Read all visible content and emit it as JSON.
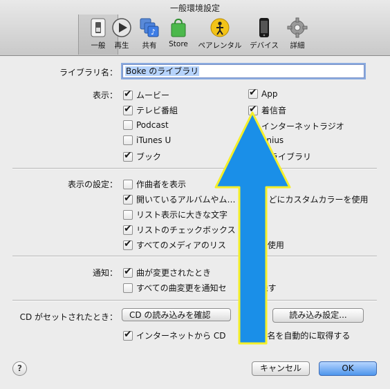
{
  "window": {
    "title": "一般環境設定"
  },
  "toolbar": {
    "items": [
      {
        "label": "一般",
        "icon": "general-switch-icon"
      },
      {
        "label": "再生",
        "icon": "play-icon"
      },
      {
        "label": "共有",
        "icon": "sharing-icon"
      },
      {
        "label": "Store",
        "icon": "store-bag-icon"
      },
      {
        "label": "ペアレンタル",
        "icon": "parental-icon"
      },
      {
        "label": "デバイス",
        "icon": "device-icon"
      },
      {
        "label": "詳細",
        "icon": "gear-icon"
      }
    ]
  },
  "library": {
    "label": "ライブラリ名：",
    "value": "Boke のライブラリ"
  },
  "display": {
    "label": "表示：",
    "left": [
      {
        "label": "ムービー",
        "checked": true
      },
      {
        "label": "テレビ番組",
        "checked": true
      },
      {
        "label": "Podcast",
        "checked": false
      },
      {
        "label": "iTunes U",
        "checked": false
      },
      {
        "label": "ブック",
        "checked": true
      }
    ],
    "right": [
      {
        "label": "App",
        "checked": true
      },
      {
        "label": "着信音",
        "checked": true
      },
      {
        "label": "インターネットラジオ",
        "checked": false
      },
      {
        "label": "enius",
        "checked": false
      },
      {
        "label": "有ライブラリ",
        "checked": false
      }
    ]
  },
  "display_settings": {
    "label": "表示の設定：",
    "options": [
      {
        "label": "作曲者を表示",
        "checked": false
      },
      {
        "label": "開いているアルバムやム…　　　　どにカスタムカラーを使用",
        "checked": true
      },
      {
        "label": "リスト表示に大きな文字",
        "checked": false
      },
      {
        "label": "リストのチェックボックス",
        "checked": true
      },
      {
        "label": "すべてのメディアのリス　　　　　使用",
        "checked": true
      }
    ]
  },
  "notifications": {
    "label": "通知：",
    "options": [
      {
        "label": "曲が変更されたとき",
        "checked": true
      },
      {
        "label": "すべての曲変更を通知セ　　　　残す",
        "checked": false
      }
    ]
  },
  "cd": {
    "label": "CD がセットされたとき：",
    "popup": "CD の読み込みを確認",
    "import_button": "読み込み設定...",
    "auto_fetch": {
      "label": "インターネットから CD　　　　ク名を自動的に取得する",
      "checked": true
    }
  },
  "footer": {
    "help": "?",
    "cancel": "キャンセル",
    "ok": "OK"
  },
  "annotation": {
    "arrow_fill": "#1a8fe8",
    "arrow_stroke": "#f5ef2a"
  }
}
